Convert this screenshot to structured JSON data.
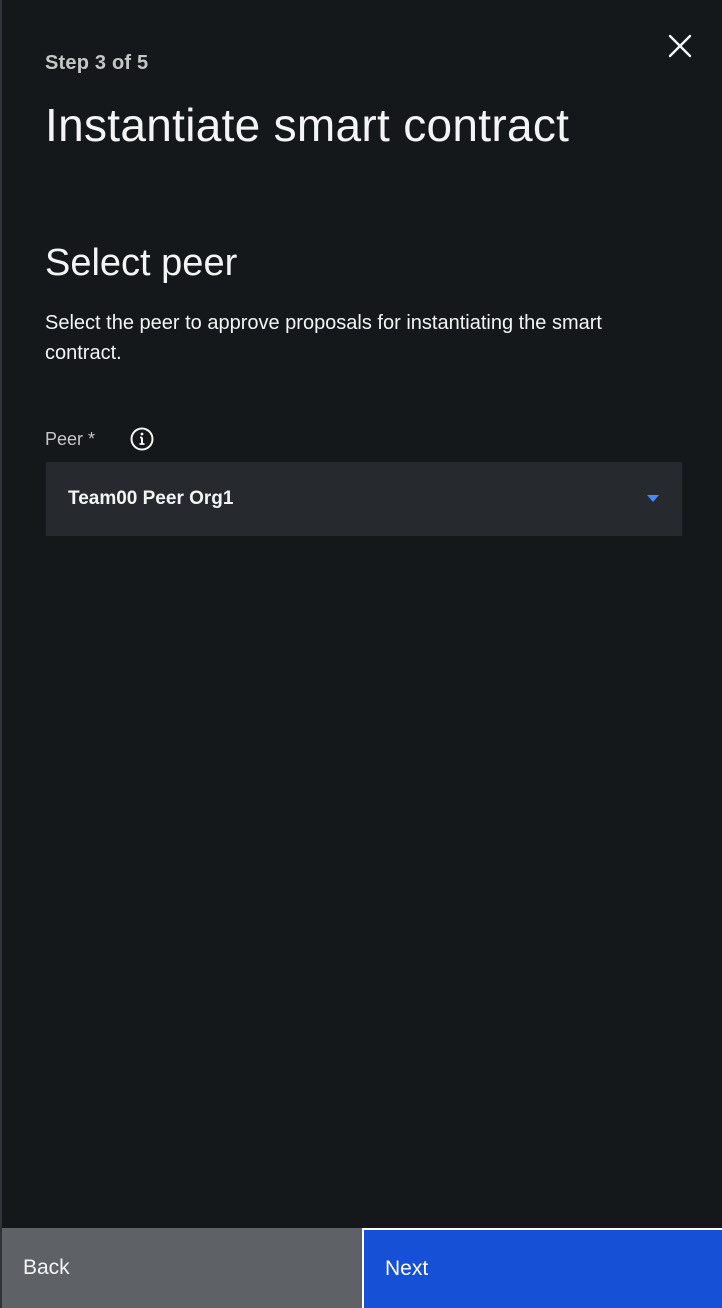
{
  "header": {
    "step_label": "Step 3 of 5",
    "title": "Instantiate smart contract",
    "close_icon": "close-icon"
  },
  "section": {
    "title": "Select peer",
    "description": "Select the peer to approve proposals for instantiating the smart contract."
  },
  "peer_field": {
    "label": "Peer *",
    "info_icon": "info-icon",
    "selected_value": "Team00 Peer Org1",
    "caret_icon": "caret-down-icon"
  },
  "footer": {
    "back_label": "Back",
    "next_label": "Next"
  },
  "colors": {
    "background": "#15181b",
    "field_background": "#262a2f",
    "accent_blue": "#1550d6",
    "caret_blue": "#4589ff",
    "back_button": "#5e6166"
  }
}
